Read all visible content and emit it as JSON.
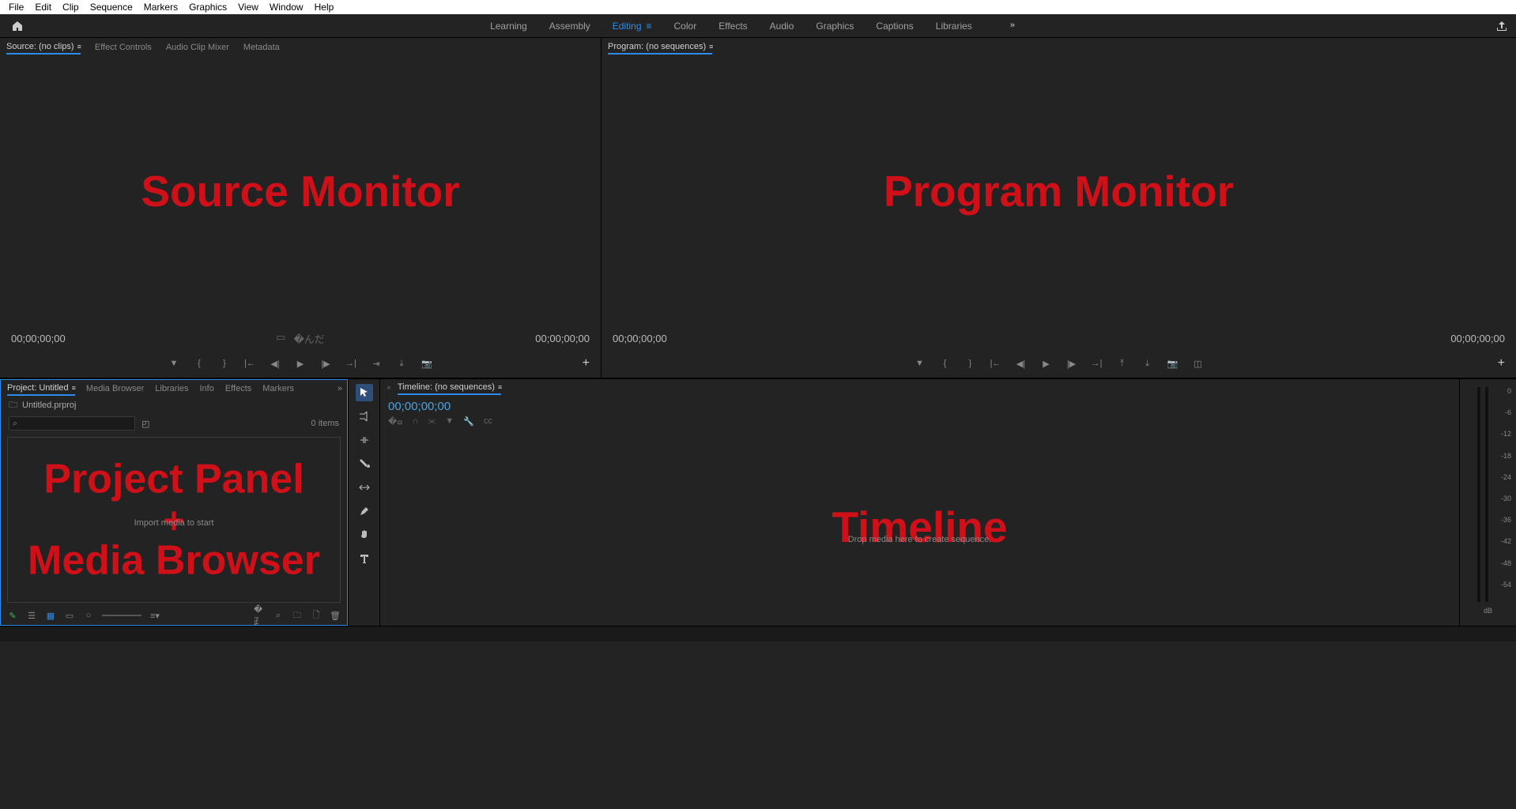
{
  "menu": [
    "File",
    "Edit",
    "Clip",
    "Sequence",
    "Markers",
    "Graphics",
    "View",
    "Window",
    "Help"
  ],
  "workspaces": {
    "items": [
      "Learning",
      "Assembly",
      "Editing",
      "Color",
      "Effects",
      "Audio",
      "Graphics",
      "Captions",
      "Libraries"
    ],
    "active": "Editing"
  },
  "source_panel": {
    "tabs": [
      "Source: (no clips)",
      "Effect Controls",
      "Audio Clip Mixer",
      "Metadata"
    ],
    "active": 0,
    "timecode_left": "00;00;00;00",
    "timecode_right": "00;00;00;00",
    "overlay": "Source Monitor"
  },
  "program_panel": {
    "tab": "Program: (no sequences)",
    "timecode_left": "00;00;00;00",
    "timecode_right": "00;00;00;00",
    "overlay": "Program Monitor"
  },
  "project_panel": {
    "tabs": [
      "Project: Untitled",
      "Media Browser",
      "Libraries",
      "Info",
      "Effects",
      "Markers"
    ],
    "active": 0,
    "project_file": "Untitled.prproj",
    "search_placeholder": "",
    "items_count": "0 items",
    "hint": "Import media to start",
    "overlay_line1": "Project Panel",
    "overlay_plus": "+",
    "overlay_line2": "Media Browser"
  },
  "timeline_panel": {
    "tab": "Timeline: (no sequences)",
    "timecode": "00;00;00;00",
    "hint": "Drop media here to create sequence.",
    "overlay": "Timeline"
  },
  "meter": {
    "ticks": [
      "0",
      "-6",
      "-12",
      "-18",
      "-24",
      "-30",
      "-36",
      "-42",
      "-48",
      "-54",
      ""
    ],
    "unit": "dB"
  },
  "tools": [
    "selection",
    "track-select",
    "ripple",
    "razor",
    "slip",
    "pen",
    "hand",
    "type"
  ],
  "transport_icons": [
    "marker",
    "in-bracket",
    "out-bracket",
    "go-in",
    "step-back",
    "play",
    "step-fwd",
    "go-out",
    "insert",
    "overwrite",
    "export-frame"
  ],
  "colors": {
    "accent": "#2d8ceb",
    "annot": "#d01018"
  }
}
